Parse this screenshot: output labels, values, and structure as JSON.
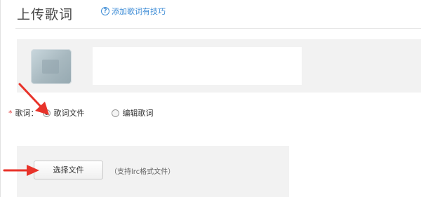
{
  "page": {
    "title": "上传歌词",
    "help_link": "添加歌词有技巧",
    "help_icon_glyph": "?"
  },
  "lyrics_field": {
    "required_mark": "*",
    "label": "歌词：",
    "options": [
      {
        "label": "歌词文件",
        "checked": true
      },
      {
        "label": "编辑歌词",
        "checked": false
      }
    ]
  },
  "upload": {
    "button_label": "选择文件",
    "hint": "（支持lrc格式文件）"
  },
  "colors": {
    "annotation_arrow": "#e8332a",
    "link": "#3d8cd6",
    "panel_bg": "#f2f2f2"
  }
}
